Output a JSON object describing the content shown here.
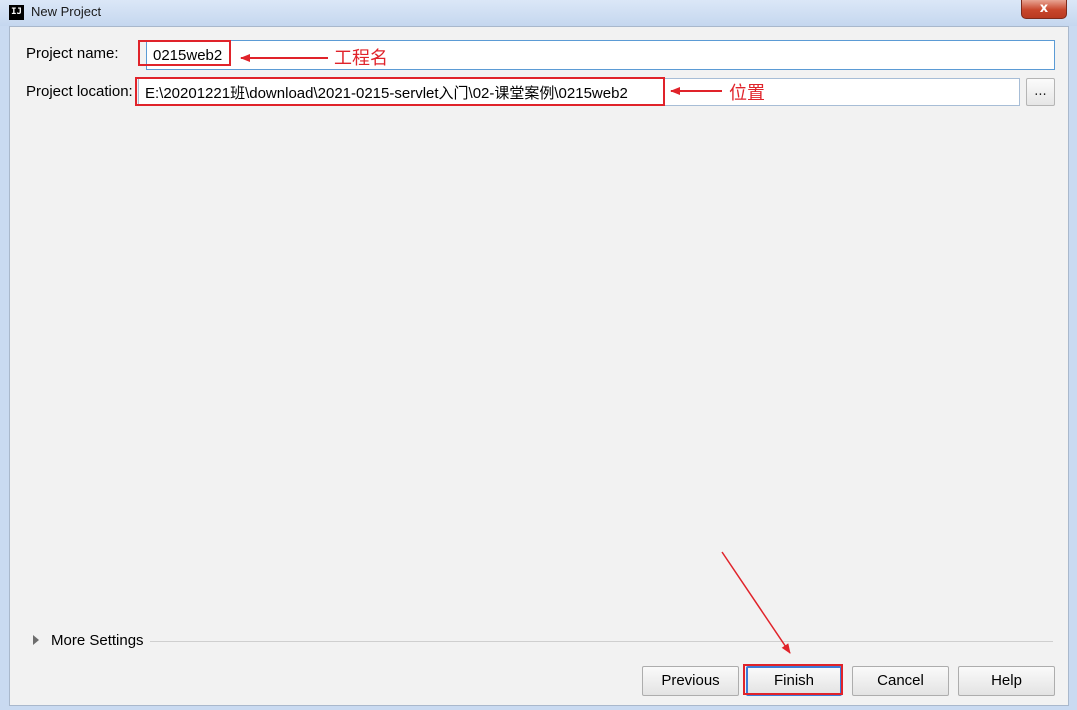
{
  "window": {
    "title": "New Project",
    "icon_text": "IJ",
    "close_symbol": "x"
  },
  "form": {
    "name_label": "Project name:",
    "name_value": "0215web2",
    "location_label": "Project location:",
    "location_value": "E:\\20201221班\\download\\2021-0215-servlet入门\\02-课堂案例\\0215web2",
    "browse_label": "..."
  },
  "annotations": {
    "name_note": "工程名",
    "location_note": "位置",
    "color": "#e0232a"
  },
  "more_settings": {
    "label": "More Settings"
  },
  "buttons": {
    "previous": "Previous",
    "finish": "Finish",
    "cancel": "Cancel",
    "help": "Help"
  }
}
